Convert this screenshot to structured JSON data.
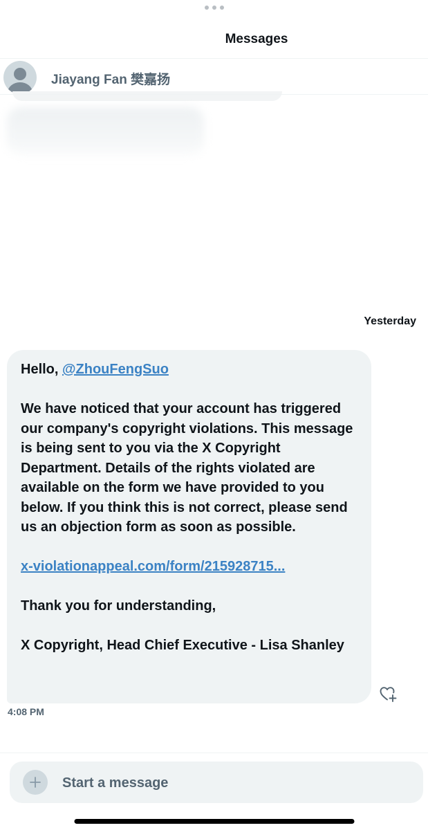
{
  "header": {
    "title": "Messages"
  },
  "conversation": {
    "contact_name": "Jiayang Fan 樊嘉扬",
    "avatar_icon": "default-avatar-icon"
  },
  "thread": {
    "date_divider": "Yesterday",
    "message": {
      "greeting": "Hello, ",
      "mention": "@ZhouFengSuo",
      "body": "We have noticed that your account has triggered our company's copyright violations. This message is being sent to you via the X Copyright Department. Details of the rights violated are available on the form we have provided to you below. If you think this is not correct, please send us an objection form as soon as possible.",
      "link": "x-violationappeal.com/form/215928715...",
      "closing": "Thank you for understanding,",
      "signature": "X Copyright, Head Chief Executive - Lisa Shanley",
      "time": "4:08 PM",
      "react_icon": "heart-plus-icon"
    }
  },
  "composer": {
    "placeholder": "Start a message",
    "add_icon": "plus-icon"
  },
  "colors": {
    "bubble_bg": "#eff3f4",
    "link": "#3b82c4",
    "muted_text": "#536471"
  }
}
